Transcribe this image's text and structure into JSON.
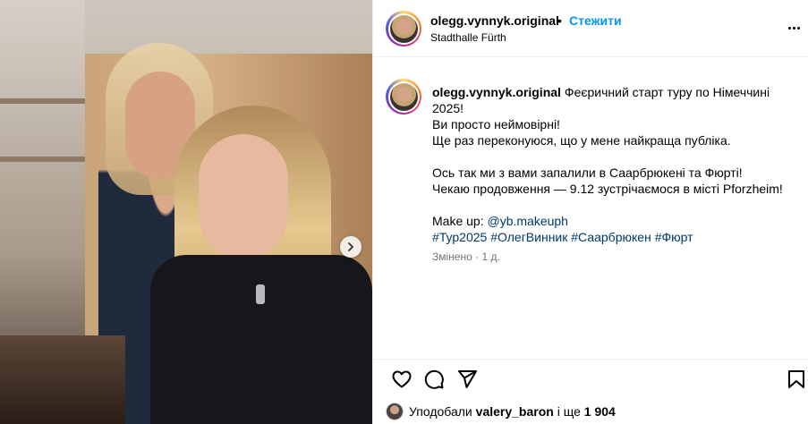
{
  "post": {
    "username": "olegg.vynnyk.original",
    "separator": "•",
    "follow_label": "Стежити",
    "location": "Stadthalle Fürth"
  },
  "caption": {
    "username": "olegg.vynnyk.original",
    "line1": "Феєричний старт туру по Німеччині 2025!",
    "line2": "Ви просто неймовірні!",
    "line3": "Ще раз переконуюся, що у мене найкраща публіка.",
    "line4": "Ось так ми з вами запалили в Саарбрюкені та Фюрті!",
    "line5": "Чекаю продовження — 9.12 зустрічаємося в місті Pforzheim!",
    "makeup_prefix": "Make up:",
    "makeup_mention": "@yb.makeuph",
    "hashtags": [
      "#Тур2025",
      "#ОлегВинник",
      "#Саарбрюкен",
      "#Фюрт"
    ],
    "edited": "Змінено",
    "dot": "·",
    "time": "1 д."
  },
  "likes": {
    "prefix": "Уподобали",
    "user": "valery_baron",
    "middle": "і ще",
    "count": "1 904"
  },
  "icons": {
    "more": "more-horizontal-icon",
    "like": "heart-icon",
    "comment": "comment-icon",
    "share": "send-icon",
    "save": "bookmark-icon",
    "next": "chevron-right-icon"
  }
}
